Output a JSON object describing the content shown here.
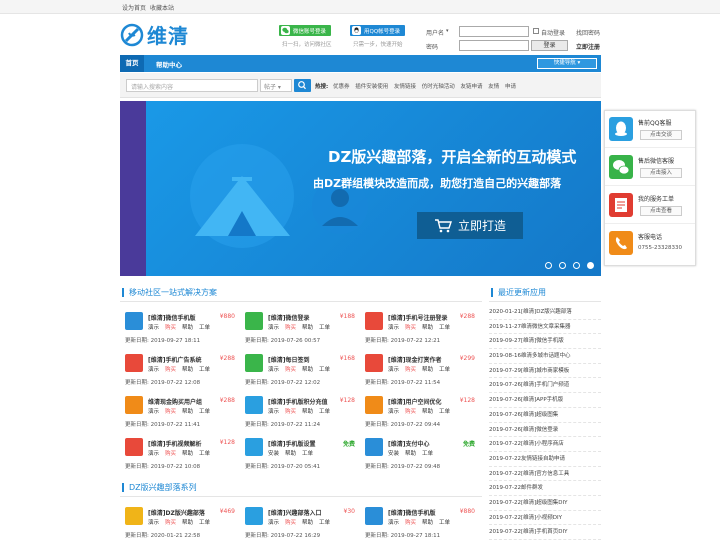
{
  "topbar": {
    "set_home": "设为首页",
    "bookmark": "收藏本站"
  },
  "logo": {
    "text": "维清"
  },
  "login": {
    "wechat_label": "微信账号登录",
    "wechat_sub": "扫一扫，访问微社区",
    "qq_label": "用QQ帐号登录",
    "qq_sub": "只需一步，快速开始",
    "username_label": "用户名",
    "username_select": "▾",
    "password_label": "密码",
    "auto_login": "自动登录",
    "find_password": "找回密码",
    "login_button": "登录",
    "register": "立即注册"
  },
  "nav": {
    "home": "首页",
    "help": "帮助中心",
    "quick": "快捷导航 ▾"
  },
  "search": {
    "placeholder": "请输入搜索内容",
    "type": "帖子 ▾",
    "hot_label": "热搜:",
    "hot": [
      "优惠券",
      "插件安装使用",
      "友情链接",
      "仿时光轴活动",
      "友链申请",
      "友情",
      "申请"
    ]
  },
  "banner": {
    "title": "DZ版兴趣部落，开启全新的互动模式",
    "subtitle": "由DZ群组模块改造而成，助您打造自己的兴趣部落",
    "button": "立即打造"
  },
  "service": [
    {
      "title": "售前QQ客服",
      "action": "点击交谈",
      "color": "#2a9fe0"
    },
    {
      "title": "售后微信客服",
      "action": "点击接入",
      "color": "#38b349"
    },
    {
      "title": "我的服务工单",
      "action": "点击查看",
      "color": "#e03c31"
    },
    {
      "title": "客服电话",
      "phone": "0755-23328330",
      "color": "#f08b18"
    }
  ],
  "sections": {
    "mobile": "移动社区一站式解决方案",
    "latest": "最近更新应用",
    "dz": "DZ版兴趣部落系列"
  },
  "products_mobile": [
    {
      "name": "[维清]微信手机版",
      "price": "¥880",
      "actions": [
        "演示",
        "购买",
        "帮助",
        "工单"
      ],
      "date": "更新日期: 2019-09-27 18:11",
      "color": "#2a8ed8"
    },
    {
      "name": "[维清]微信登录",
      "price": "¥188",
      "actions": [
        "演示",
        "购买",
        "帮助",
        "工单"
      ],
      "date": "更新日期: 2019-07-26 00:57",
      "color": "#3ab54a"
    },
    {
      "name": "[维清]手机号注册登录",
      "price": "¥288",
      "actions": [
        "演示",
        "购买",
        "帮助",
        "工单"
      ],
      "date": "更新日期: 2019-07-22 12:21",
      "color": "#e8493a"
    },
    {
      "name": "[维清]手机广告系统",
      "price": "¥288",
      "actions": [
        "演示",
        "购买",
        "帮助",
        "工单"
      ],
      "date": "更新日期: 2019-07-22 12:08",
      "color": "#e8493a"
    },
    {
      "name": "[维清]每日签到",
      "price": "¥168",
      "actions": [
        "演示",
        "购买",
        "帮助",
        "工单"
      ],
      "date": "更新日期: 2019-07-22 12:02",
      "color": "#3ab54a"
    },
    {
      "name": "[维清]现金打赏作者",
      "price": "¥299",
      "actions": [
        "演示",
        "购买",
        "帮助",
        "工单"
      ],
      "date": "更新日期: 2019-07-22 11:54",
      "color": "#e8493a"
    },
    {
      "name": "维清现金购买用户组",
      "price": "¥288",
      "actions": [
        "演示",
        "购买",
        "帮助",
        "工单"
      ],
      "date": "更新日期: 2019-07-22 11:41",
      "color": "#f08b18"
    },
    {
      "name": "[维清]手机版积分充值",
      "price": "¥128",
      "actions": [
        "演示",
        "购买",
        "帮助",
        "工单"
      ],
      "date": "更新日期: 2019-07-22 11:24",
      "color": "#2a9fe0"
    },
    {
      "name": "[维清]用户空间优化",
      "price": "¥128",
      "actions": [
        "演示",
        "购买",
        "帮助",
        "工单"
      ],
      "date": "更新日期: 2019-07-22 09:44",
      "color": "#f08b18"
    },
    {
      "name": "[维清]手机视频解析",
      "price": "¥128",
      "actions": [
        "演示",
        "购买",
        "帮助",
        "工单"
      ],
      "date": "更新日期: 2019-07-22 10:08",
      "color": "#e8493a"
    },
    {
      "name": "[维清]手机版设置",
      "price": "免费",
      "actions": [
        "安装",
        "帮助",
        "工单"
      ],
      "date": "更新日期: 2019-07-20 05:41",
      "color": "#2a9fe0"
    },
    {
      "name": "[维清]支付中心",
      "price": "免费",
      "actions": [
        "安装",
        "帮助",
        "工单"
      ],
      "date": "更新日期: 2019-07-22 09:48",
      "color": "#2a8ed8"
    }
  ],
  "products_dz": [
    {
      "name": "[维清]DZ版兴趣部落",
      "price": "¥469",
      "actions": [
        "演示",
        "购买",
        "帮助",
        "工单"
      ],
      "date": "更新日期: 2020-01-21 22:58",
      "color": "#f0b418"
    },
    {
      "name": "[维清]兴趣部落入口",
      "price": "¥30",
      "actions": [
        "演示",
        "购买",
        "帮助",
        "工单"
      ],
      "date": "更新日期: 2019-07-22 16:29",
      "color": "#2a9fe0"
    },
    {
      "name": "[维清]微信手机版",
      "price": "¥880",
      "actions": [
        "演示",
        "购买",
        "帮助",
        "工单"
      ],
      "date": "更新日期: 2019-09-27 18:11",
      "color": "#2a8ed8"
    }
  ],
  "latest": [
    "2020-01-21[维清]DZ版兴趣部落",
    "2019-11-27维清微信文章采集器",
    "2019-09-27[维清]微信手机版",
    "2019-08-16维清多城市话题中心",
    "2019-07-29[维清]城市商家模板",
    "2019-07-26[维清]手机门户频道",
    "2019-07-26[维清]APP手机版",
    "2019-07-26[维清]超级图集",
    "2019-07-26[维清]微信登录",
    "2019-07-22[维清]小程序商店",
    "2019-07-22友情链接自助申请",
    "2019-07-22[维清]官方信息工具",
    "2019-07-22邮件群发",
    "2019-07-22[维清]超级图集DIY",
    "2019-07-22[维清]小视频DIY",
    "2019-07-22[维清]手机首页DIY"
  ]
}
